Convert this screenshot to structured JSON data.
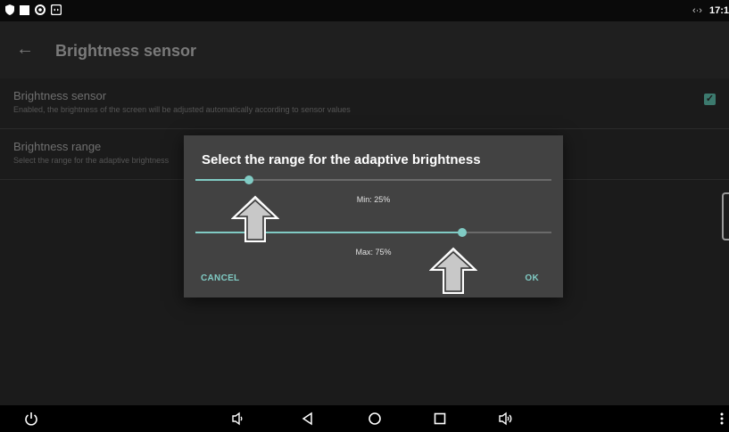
{
  "status_bar": {
    "time": "17:1",
    "icons": [
      "shield-icon",
      "square-icon",
      "eye-icon",
      "teamviewer-icon"
    ],
    "signal_glyph": "‹·›"
  },
  "appbar": {
    "back_glyph": "←",
    "title": "Brightness sensor"
  },
  "preferences": [
    {
      "title": "Brightness sensor",
      "summary": "Enabled, the brightness of the screen will be adjusted automatically according to sensor values",
      "checked": true
    },
    {
      "title": "Brightness range",
      "summary": "Select the range for the adaptive brightness"
    }
  ],
  "dialog": {
    "title": "Select the range for the adaptive brightness",
    "min_slider": {
      "value_percent": 25,
      "label": "Min: 25%"
    },
    "max_slider": {
      "value_percent": 75,
      "label": "Max: 75%"
    },
    "cancel_label": "CANCEL",
    "ok_label": "OK"
  },
  "navigation_bar": {
    "icons": [
      "power-icon",
      "volume-down-icon",
      "back-icon",
      "home-icon",
      "recents-icon",
      "volume-up-icon",
      "more-icon"
    ]
  },
  "colors": {
    "accent": "#80cbc4",
    "dialog_bg": "#424242",
    "checkbox": "#3c7a6e"
  }
}
